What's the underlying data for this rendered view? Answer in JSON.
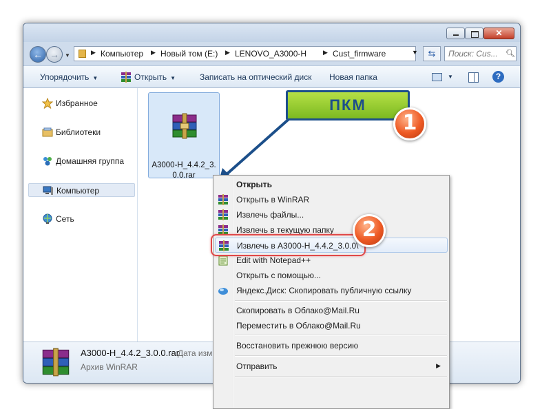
{
  "window": {
    "address": [
      "Компьютер",
      "Новый том (E:)",
      "LENOVO_A3000-H",
      "Cust_firmware"
    ],
    "search_placeholder": "Поиск: Cus..."
  },
  "toolbar": {
    "organize": "Упорядочить",
    "open": "Открыть",
    "burn": "Записать на оптический диск",
    "new_folder": "Новая папка"
  },
  "sidebar": {
    "items": [
      {
        "label": "Избранное",
        "icon": "star-icon"
      },
      {
        "label": "Библиотеки",
        "icon": "libraries-icon"
      },
      {
        "label": "Домашняя группа",
        "icon": "homegroup-icon"
      },
      {
        "label": "Компьютер",
        "icon": "computer-icon",
        "selected": true
      },
      {
        "label": "Сеть",
        "icon": "network-icon"
      }
    ]
  },
  "file": {
    "name_line1": "A3000-H_4.4.2_3.",
    "name_line2": "0.0.rar"
  },
  "details": {
    "filename": "A3000-H_4.4.2_3.0.0.rar",
    "date_label": "Дата изм",
    "type": "Архив WinRAR"
  },
  "context_menu": {
    "items": [
      {
        "label": "Открыть",
        "bold": true,
        "icon": "none"
      },
      {
        "label": "Открыть в WinRAR",
        "icon": "winrar-icon"
      },
      {
        "label": "Извлечь файлы...",
        "icon": "winrar-icon"
      },
      {
        "label": "Извлечь в текущую папку",
        "icon": "winrar-icon"
      },
      {
        "label": "Извлечь в A3000-H_4.4.2_3.0.0\\",
        "icon": "winrar-icon",
        "highlighted": true
      },
      {
        "label": "Edit with Notepad++",
        "icon": "notepad-icon"
      },
      {
        "label": "Открыть с помощью...",
        "icon": "none"
      },
      {
        "label": "Яндекс.Диск: Скопировать публичную ссылку",
        "icon": "yandex-disk-icon"
      },
      {
        "label": "Скопировать в Облако@Mail.Ru",
        "icon": "none"
      },
      {
        "label": "Переместить в Облако@Mail.Ru",
        "icon": "none"
      },
      {
        "label": "Восстановить прежнюю версию",
        "icon": "none"
      },
      {
        "label": "Отправить",
        "icon": "none",
        "submenu": true
      }
    ]
  },
  "annotations": {
    "callout": "ПКМ",
    "step1": "1",
    "step2": "2"
  },
  "colors": {
    "callout_fill": "#8ccb2a",
    "callout_border": "#1c4f8a",
    "badge": "#ee5a24",
    "highlight_box": "#e04848"
  }
}
